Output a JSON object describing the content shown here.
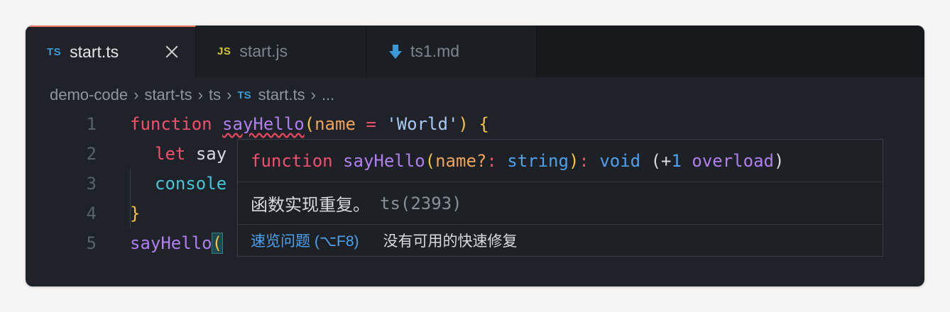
{
  "tabs": [
    {
      "icon": "TS",
      "icon_color": "#3b9bd8",
      "label": "start.ts",
      "active": true
    },
    {
      "icon": "JS",
      "icon_color": "#d4c62e",
      "label": "start.js",
      "active": false
    },
    {
      "icon": "markdown-arrow-icon",
      "icon_color": "#3b9bd8",
      "label": "ts1.md",
      "active": false
    }
  ],
  "breadcrumb": {
    "items": [
      "demo-code",
      "start-ts",
      "ts"
    ],
    "file_icon": "TS",
    "file": "start.ts",
    "more": "..."
  },
  "editor": {
    "line_numbers": [
      "1",
      "2",
      "3",
      "4",
      "5"
    ],
    "line1": {
      "kw": "function",
      "fn": "sayHello",
      "open": "(",
      "param": "name",
      "eq": " = ",
      "str": "'World'",
      "close": ")",
      "brace": "{"
    },
    "line2": {
      "kw": "let",
      "rest": "say"
    },
    "line3": {
      "obj": "console"
    },
    "line4": {
      "brace": "}"
    },
    "line5": {
      "fn": "sayHello",
      "open": "("
    }
  },
  "hover": {
    "sig": {
      "kw": "function",
      "fn": "sayHello",
      "open": "(",
      "param": "name?",
      "colon": ": ",
      "type": "string",
      "close": ")",
      "colon2": ": ",
      "ret": "void",
      "overload_open": "(+",
      "overload_num": "1",
      "overload_word": "overload",
      "overload_close": ")"
    },
    "message": "函数实现重复。",
    "code_ref": "ts(2393)",
    "peek_link": "速览问题 (⌥F8)",
    "no_fix": "没有可用的快速修复"
  },
  "colors": {
    "keyword": "#f0506e",
    "function": "#b07ff0",
    "parameter": "#f0a35c",
    "string": "#a9c8f3",
    "type": "#4ea1ee",
    "link": "#4ea1ee",
    "error_squiggle": "#e5485f",
    "active_tab_border": "#e8765c"
  }
}
